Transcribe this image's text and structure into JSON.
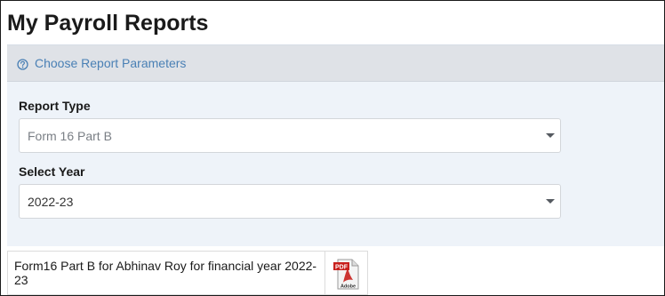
{
  "page": {
    "title": "My Payroll Reports"
  },
  "parameters_panel": {
    "header_label": "Choose Report Parameters",
    "header_icon": "help-circle-icon"
  },
  "report_type": {
    "label": "Report Type",
    "selected": "Form 16 Part B"
  },
  "select_year": {
    "label": "Select Year",
    "selected": "2022-23"
  },
  "result": {
    "description": "Form16 Part B for Abhinav Roy for financial year 2022-23",
    "icon": "pdf-icon",
    "icon_badge": "PDF",
    "icon_caption": "Adobe"
  },
  "colors": {
    "accent_link": "#4a80b5",
    "panel_bg": "#eef3f9",
    "panel_header_bg": "#dfe2e7",
    "pdf_red": "#c8201d"
  }
}
